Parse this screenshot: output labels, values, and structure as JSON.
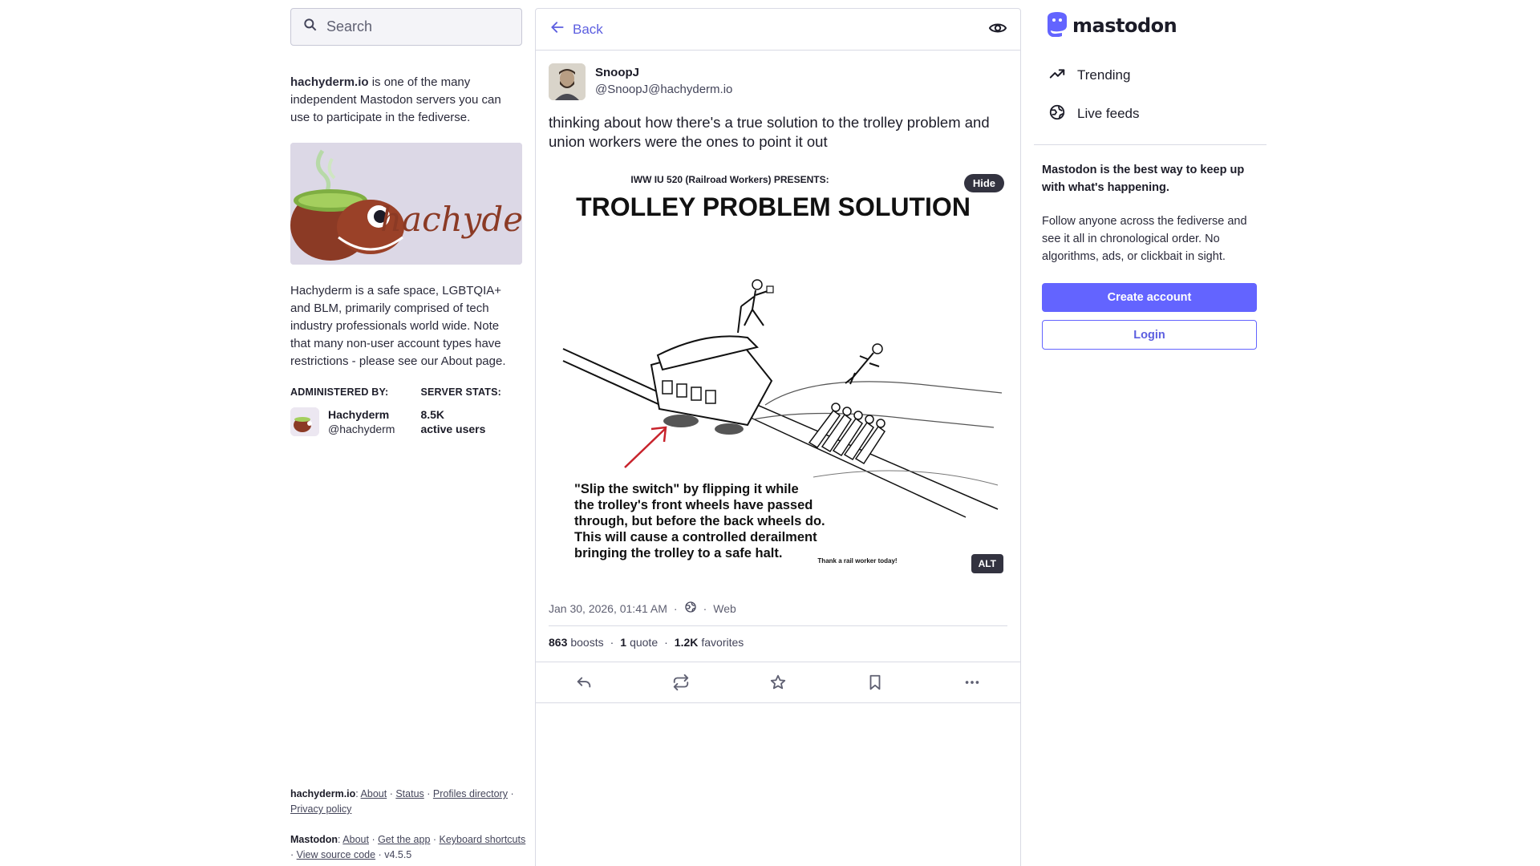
{
  "search": {
    "placeholder": "Search"
  },
  "server": {
    "domain": "hachyderm.io",
    "about_rest": " is one of the many independent Mastodon servers you can use to participate in the fediverse.",
    "banner_text": "hachyderm",
    "description": "Hachyderm is a safe space, LGBTQIA+ and BLM, primarily comprised of tech industry professionals world wide. Note that many non-user account types have restrictions - please see our About page.",
    "administered_by_label": "ADMINISTERED BY:",
    "server_stats_label": "SERVER STATS:",
    "admin_name": "Hachyderm",
    "admin_handle": "@hachyderm",
    "active_users": "8.5K",
    "active_users_label": "active users"
  },
  "footer": {
    "server_label": "hachyderm.io",
    "about": "About",
    "status": "Status",
    "profiles_directory": "Profiles directory",
    "privacy_policy": "Privacy policy",
    "mastodon_label": "Mastodon",
    "mastodon_about": "About",
    "get_app": "Get the app",
    "keyboard_shortcuts": "Keyboard shortcuts",
    "view_source": "View source code",
    "version": "v4.5.5"
  },
  "header": {
    "back_label": "Back"
  },
  "post": {
    "display_name": "SnoopJ",
    "acct": "@SnoopJ@hachyderm.io",
    "content": "thinking about how there's a true solution to the trolley problem and union workers were the ones to point it out",
    "media": {
      "hide_label": "Hide",
      "alt_label": "ALT",
      "pretitle": "IWW IU 520 (Railroad Workers) PRESENTS:",
      "title": "TROLLEY PROBLEM SOLUTION",
      "caption_lines": [
        "\"Slip the switch\" by flipping it while",
        "the trolley's front wheels have passed",
        "through, but before the back wheels do.",
        "This will cause a controlled derailment",
        "bringing the trolley to a safe halt."
      ],
      "thanks": "Thank a rail worker today!"
    },
    "timestamp": "Jan 30, 2026, 01:41 AM",
    "application": "Web",
    "boosts_count": "863",
    "boosts_label": "boosts",
    "quotes_count": "1",
    "quotes_label": "quote",
    "favorites_count": "1.2K",
    "favorites_label": "favorites"
  },
  "brand": {
    "wordmark": "mastodon",
    "accent": "#6364ff"
  },
  "nav": {
    "trending": "Trending",
    "live_feeds": "Live feeds"
  },
  "promo": {
    "title": "Mastodon is the best way to keep up with what's happening.",
    "text": "Follow anyone across the fediverse and see it all in chronological order. No algorithms, ads, or clickbait in sight.",
    "create_account": "Create account",
    "login": "Login"
  },
  "icons": [
    "search-icon",
    "back-arrow-icon",
    "eye-icon",
    "globe-icon",
    "reply-icon",
    "boost-icon",
    "star-icon",
    "bookmark-icon",
    "more-icon",
    "trending-icon",
    "globe-icon"
  ]
}
